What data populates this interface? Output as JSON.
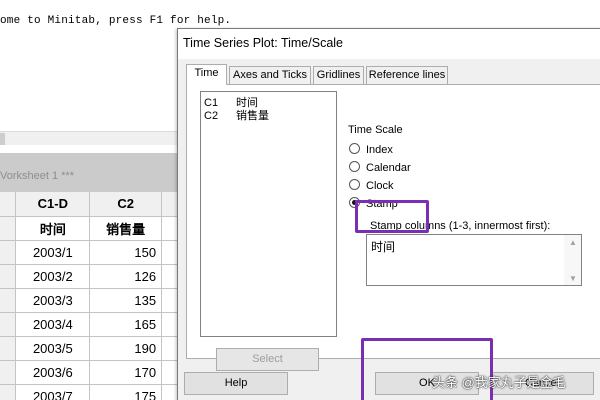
{
  "session": {
    "welcome_text": "ome to Minitab, press F1 for help."
  },
  "worksheet": {
    "title": "Vorksheet 1 ***",
    "column_ids": [
      "C1-D",
      "C2"
    ],
    "column_names": [
      "时间",
      "销售量"
    ],
    "rows": [
      {
        "date": "2003/1",
        "sales": "150"
      },
      {
        "date": "2003/2",
        "sales": "126"
      },
      {
        "date": "2003/3",
        "sales": "135"
      },
      {
        "date": "2003/4",
        "sales": "165"
      },
      {
        "date": "2003/5",
        "sales": "190"
      },
      {
        "date": "2003/6",
        "sales": "170"
      },
      {
        "date": "2003/7",
        "sales": "175"
      }
    ]
  },
  "dialog": {
    "title": "Time Series Plot: Time/Scale",
    "tabs": [
      "Time",
      "Axes and Ticks",
      "Gridlines",
      "Reference lines"
    ],
    "active_tab": "Time",
    "variables": [
      {
        "id": "C1",
        "name": "时间"
      },
      {
        "id": "C2",
        "name": "销售量"
      }
    ],
    "select_label": "Select",
    "time_scale_label": "Time Scale",
    "options": [
      "Index",
      "Calendar",
      "Clock",
      "Stamp"
    ],
    "selected_option": "Stamp",
    "stamp_columns_label": "Stamp columns (1-3, innermost first):",
    "stamp_columns_value": "时间",
    "help_label": "Help",
    "ok_label": "OK",
    "cancel_label": "Cancel"
  },
  "annotation_color": "#7a2eb2",
  "watermark": "头条 @我家丸子是金毛"
}
